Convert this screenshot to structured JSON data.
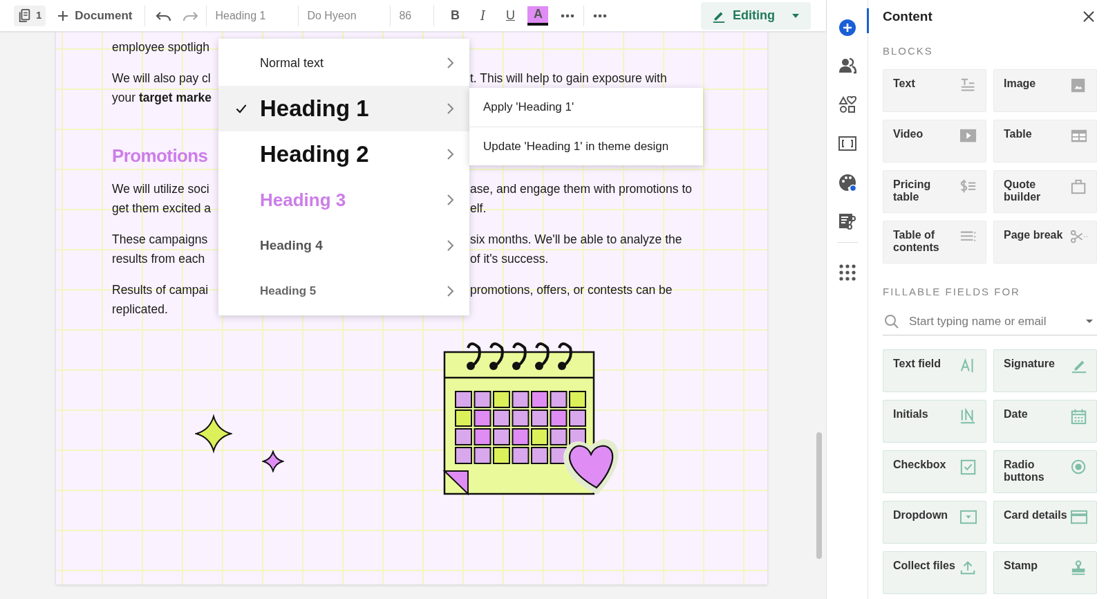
{
  "toolbar": {
    "page_count": "1",
    "document_button": "Document",
    "style_field": "Heading 1",
    "font_field": "Do Hyeon",
    "size_field": "86",
    "format_buttons": [
      {
        "label": "B",
        "kind": "bold"
      },
      {
        "label": "I",
        "kind": "italic"
      },
      {
        "label": "U",
        "kind": "underline"
      },
      {
        "label": "A",
        "kind": "color"
      }
    ],
    "mode_button": "Editing"
  },
  "document": {
    "paragraphs": [
      {
        "kind": "body",
        "lines": [
          {
            "left": "employee spotligh"
          }
        ]
      },
      {
        "kind": "body",
        "lines": [
          {
            "left": "We will also pay cl",
            "right": "t. This will help to gain exposure with"
          },
          {
            "left": "your **target marke**"
          }
        ]
      },
      {
        "kind": "heading",
        "lines": [
          {
            "left": "Promotions"
          }
        ]
      },
      {
        "kind": "body",
        "lines": [
          {
            "left": "We will utilize soci",
            "right": "ase, and engage them with promotions to"
          },
          {
            "left": "get them excited a",
            "right": "elf."
          }
        ]
      },
      {
        "kind": "body",
        "lines": [
          {
            "left": "These campaigns",
            "right": "six months. We'll be able to analyze the"
          },
          {
            "left": "results from each",
            "right": "of it's success."
          }
        ]
      },
      {
        "kind": "body",
        "lines": [
          {
            "left": "Results of campai",
            "right": "promotions, offers, or contests can be"
          },
          {
            "left": "replicated."
          }
        ]
      }
    ]
  },
  "style_menu": {
    "items": [
      {
        "label": "Normal text",
        "kind": "normal",
        "selected": false
      },
      {
        "label": "Heading 1",
        "kind": "h1",
        "selected": true
      },
      {
        "label": "Heading 2",
        "kind": "h2",
        "selected": false
      },
      {
        "label": "Heading 3",
        "kind": "h3",
        "selected": false
      },
      {
        "label": "Heading 4",
        "kind": "h4",
        "selected": false
      },
      {
        "label": "Heading 5",
        "kind": "h5",
        "selected": false
      }
    ]
  },
  "submenu": {
    "items": [
      "Apply 'Heading 1'",
      "Update 'Heading 1' in theme design"
    ]
  },
  "rail": [
    {
      "kind": "add",
      "selected": true
    },
    {
      "kind": "people",
      "selected": false
    },
    {
      "kind": "shapes",
      "selected": false
    },
    {
      "kind": "frame",
      "selected": false
    },
    {
      "kind": "palette",
      "selected": false
    },
    {
      "kind": "form",
      "selected": false
    },
    {
      "kind": "apps",
      "selected": false
    }
  ],
  "panel": {
    "title": "Content",
    "blocks_heading": "BLOCKS",
    "blocks": [
      {
        "label": "Text",
        "kind": "text"
      },
      {
        "label": "Image",
        "kind": "image"
      },
      {
        "label": "Video",
        "kind": "video"
      },
      {
        "label": "Table",
        "kind": "table"
      },
      {
        "label": "Pricing table",
        "kind": "pricing"
      },
      {
        "label": "Quote builder",
        "kind": "quote"
      },
      {
        "label": "Table of contents",
        "kind": "toc"
      },
      {
        "label": "Page break",
        "kind": "pagebreak"
      }
    ],
    "fields_heading": "FILLABLE FIELDS FOR",
    "search": {
      "placeholder": "Start typing name or email"
    },
    "fields": [
      {
        "label": "Text field",
        "kind": "textfield"
      },
      {
        "label": "Signature",
        "kind": "signature"
      },
      {
        "label": "Initials",
        "kind": "initials"
      },
      {
        "label": "Date",
        "kind": "date"
      },
      {
        "label": "Checkbox",
        "kind": "checkbox"
      },
      {
        "label": "Radio buttons",
        "kind": "radio"
      },
      {
        "label": "Dropdown",
        "kind": "dropdown"
      },
      {
        "label": "Card details",
        "kind": "card"
      },
      {
        "label": "Collect files",
        "kind": "upload"
      },
      {
        "label": "Stamp",
        "kind": "stamp"
      }
    ]
  }
}
